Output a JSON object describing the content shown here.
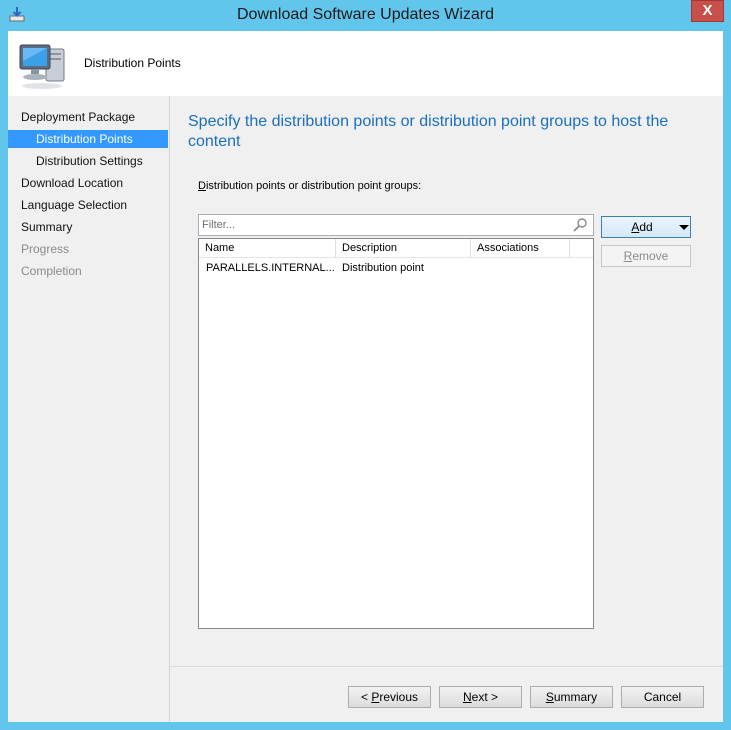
{
  "window": {
    "title": "Download Software Updates Wizard",
    "close_symbol": "X"
  },
  "header": {
    "title": "Distribution Points",
    "icon": "computer-icon"
  },
  "sidebar": {
    "items": [
      {
        "label": "Deployment Package",
        "state": "normal"
      },
      {
        "label": "Distribution Points",
        "state": "active"
      },
      {
        "label": "Distribution Settings",
        "state": "normal"
      },
      {
        "label": "Download Location",
        "state": "normal"
      },
      {
        "label": "Language Selection",
        "state": "normal"
      },
      {
        "label": "Summary",
        "state": "normal"
      },
      {
        "label": "Progress",
        "state": "disabled"
      },
      {
        "label": "Completion",
        "state": "disabled"
      }
    ]
  },
  "main": {
    "heading": "Specify the distribution points or distribution point groups to host the content",
    "list_label_mnemonic": "D",
    "list_label_rest": "istribution points or distribution point groups:",
    "filter_placeholder": "Filter...",
    "columns": [
      "Name",
      "Description",
      "Associations"
    ],
    "rows": [
      {
        "name": "PARALLELS.INTERNAL...",
        "description": "Distribution point",
        "associations": ""
      }
    ],
    "add_button": {
      "mnemonic": "A",
      "rest": "dd"
    },
    "remove_button": {
      "mnemonic": "R",
      "rest": "emove"
    }
  },
  "footer": {
    "previous": {
      "prefix": "< ",
      "mnemonic": "P",
      "rest": "revious"
    },
    "next": {
      "mnemonic": "N",
      "rest": "ext >"
    },
    "summary": {
      "mnemonic": "S",
      "rest": "ummary"
    },
    "cancel": "Cancel"
  },
  "colors": {
    "frame": "#62c6ec",
    "heading": "#1a6fbf",
    "active_item": "#3399ff",
    "close_button": "#c7504a"
  }
}
